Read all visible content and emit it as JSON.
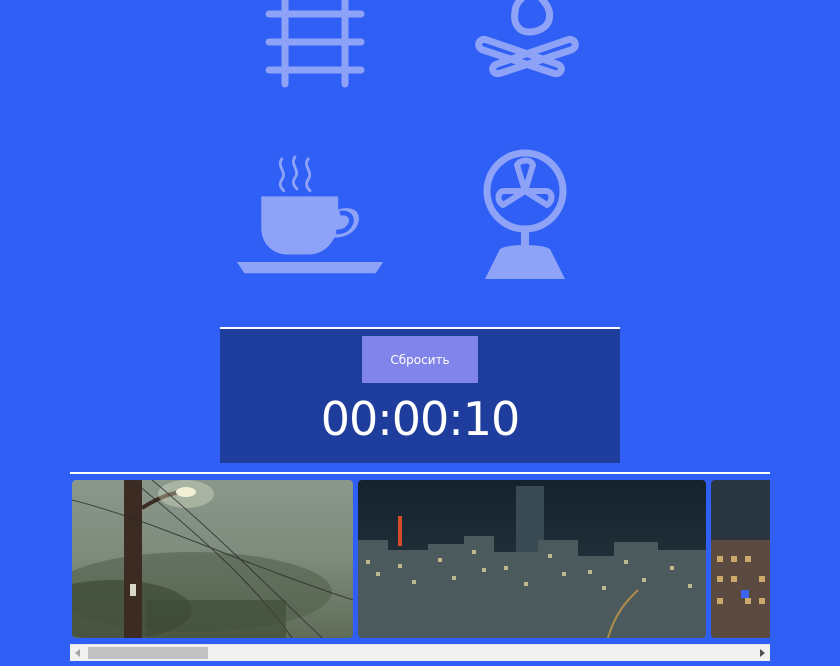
{
  "sounds": [
    {
      "name": "railroad-icon",
      "label": "railroad"
    },
    {
      "name": "campfire-icon",
      "label": "campfire"
    },
    {
      "name": "coffee-cup-icon",
      "label": "coffee"
    },
    {
      "name": "fan-icon",
      "label": "fan"
    }
  ],
  "timer": {
    "reset_label": "Сбросить",
    "time": "00:00:10"
  },
  "gallery": {
    "images": [
      {
        "name": "foggy-street-lamp-image"
      },
      {
        "name": "night-city-tokyo-tower-image"
      },
      {
        "name": "night-building-image"
      }
    ]
  },
  "colors": {
    "background": "#2f5ff5",
    "icon": "#8ea3f7",
    "panel": "#1f3d9c",
    "button": "#8185e9",
    "text": "#ffffff"
  }
}
